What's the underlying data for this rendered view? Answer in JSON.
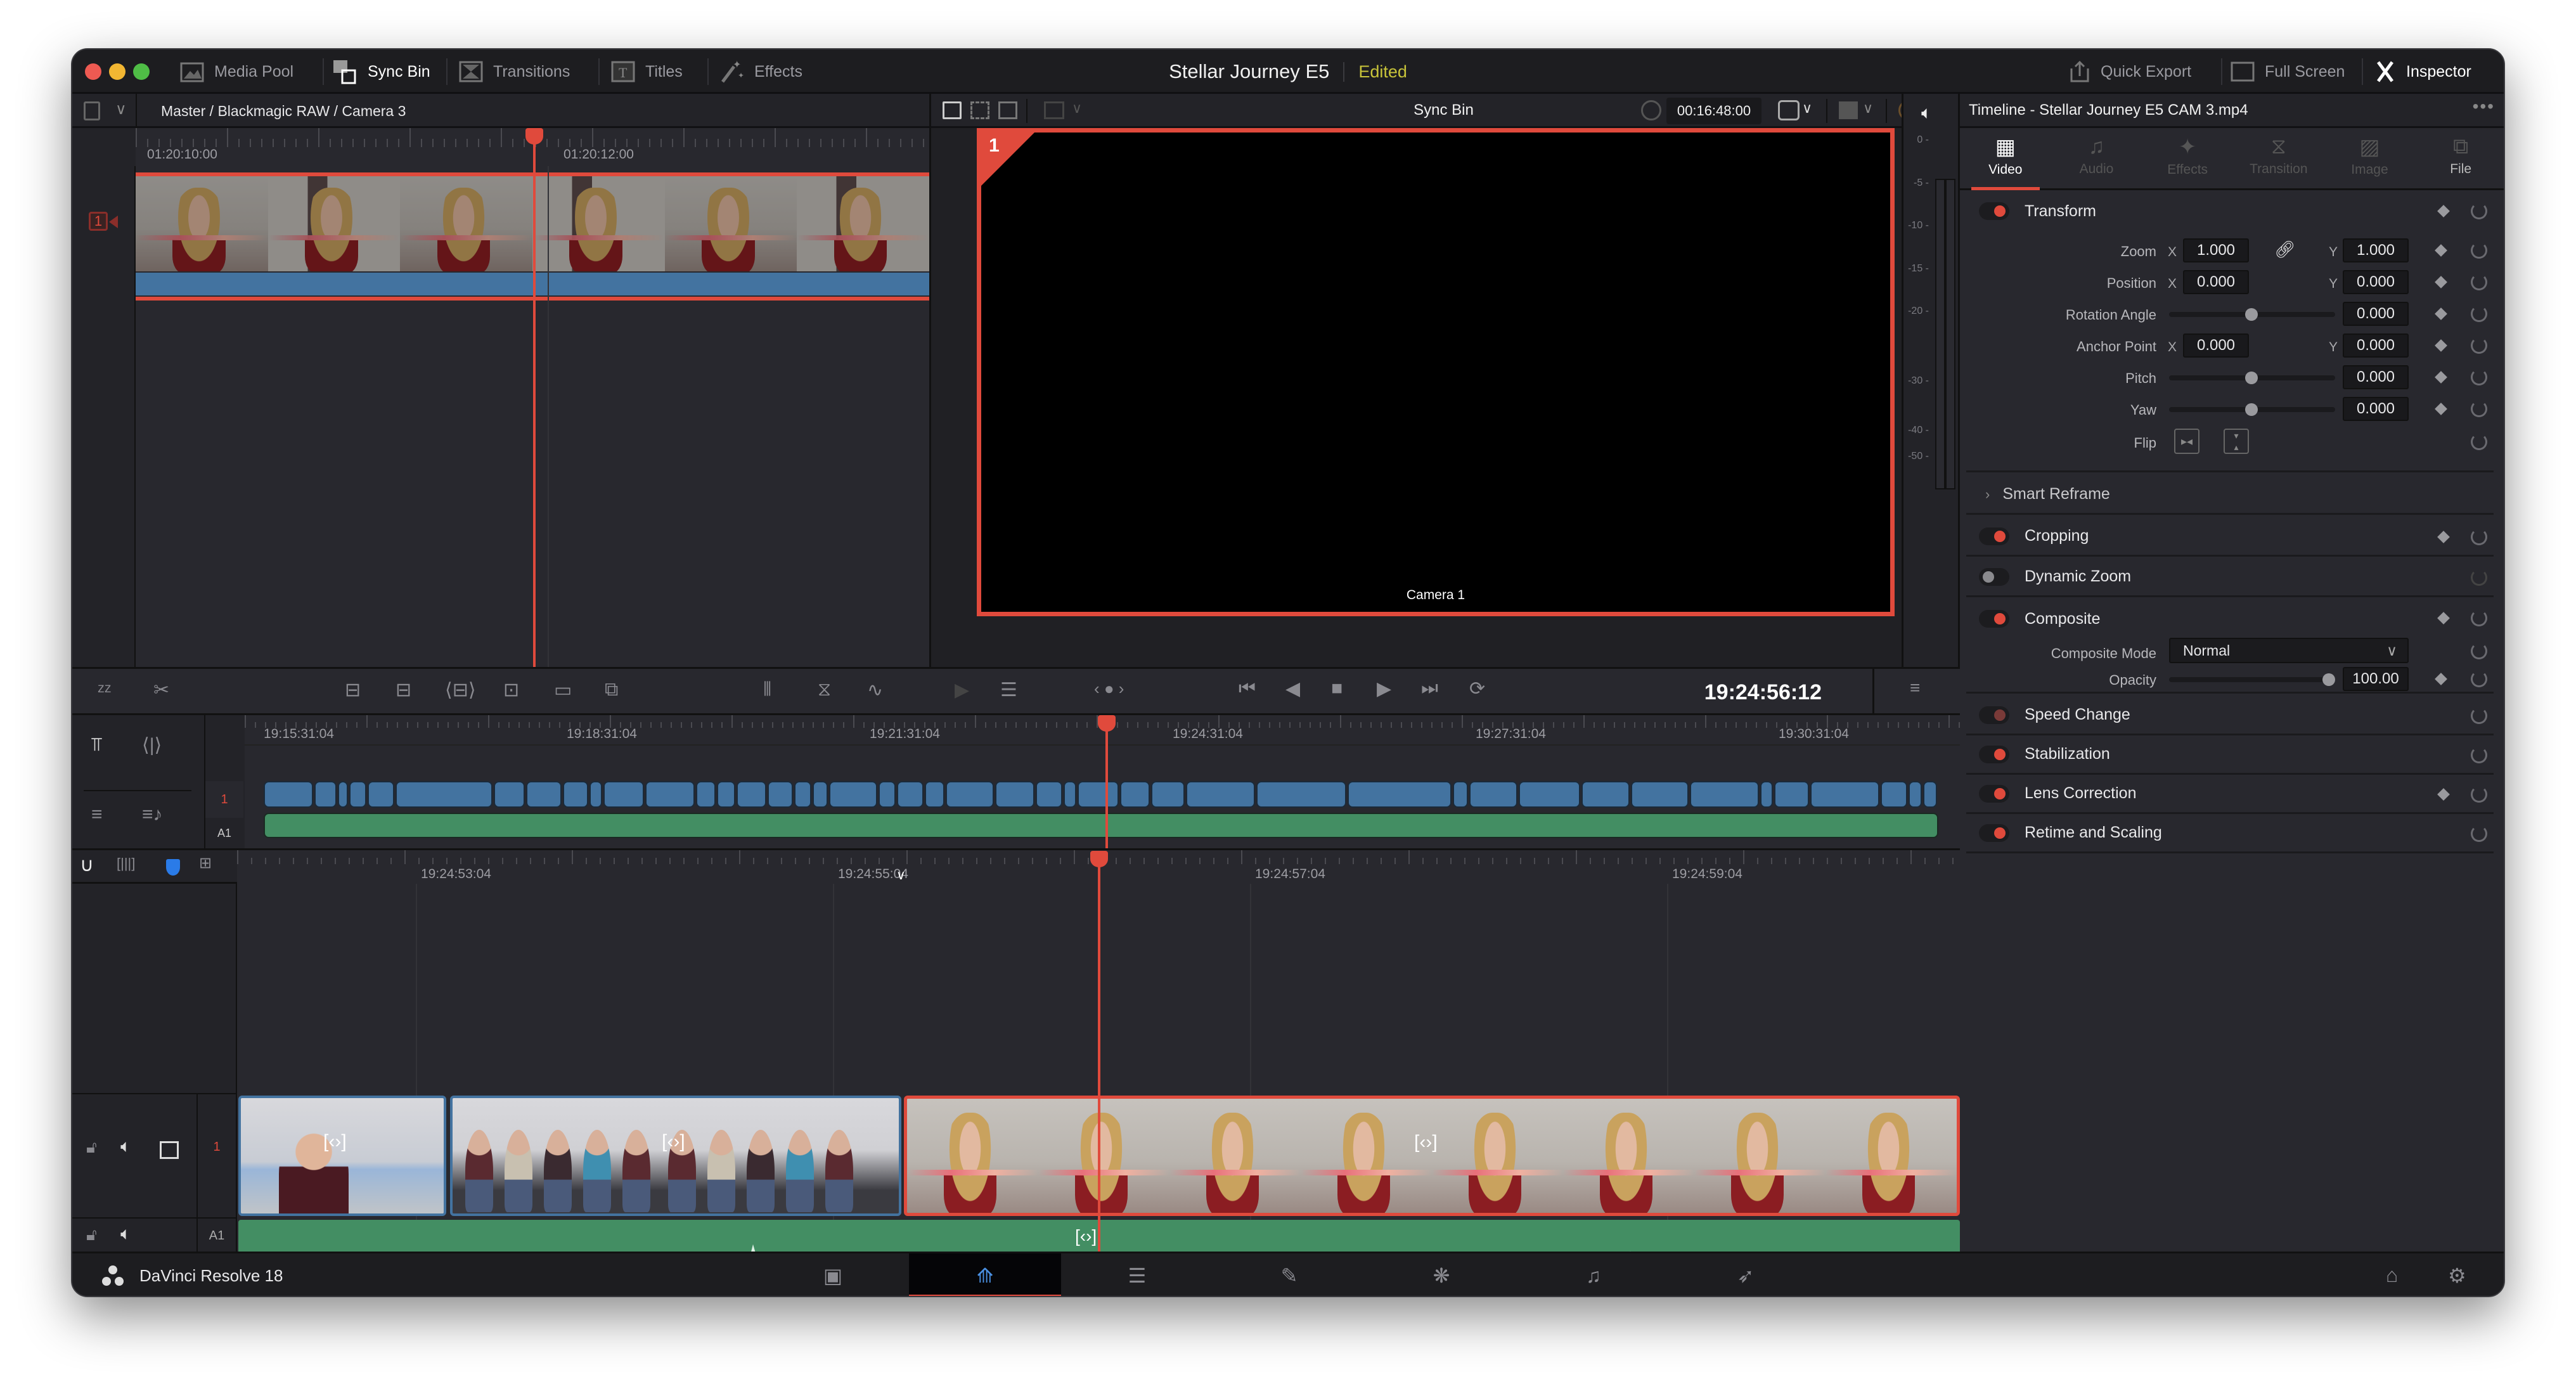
{
  "window": {
    "title": "Stellar Journey E5",
    "status": "Edited",
    "accent_color": "#e04a3c",
    "edited_color": "#c8c43a"
  },
  "topbar": {
    "left_items": [
      {
        "label": "Media Pool",
        "icon": "media-pool-icon",
        "active": false
      },
      {
        "label": "Sync Bin",
        "icon": "sync-bin-icon",
        "active": true
      },
      {
        "label": "Transitions",
        "icon": "transitions-icon",
        "active": false
      },
      {
        "label": "Titles",
        "icon": "titles-icon",
        "active": false
      },
      {
        "label": "Effects",
        "icon": "effects-icon",
        "active": false
      }
    ],
    "right_items": [
      {
        "label": "Quick Export",
        "icon": "export-icon"
      },
      {
        "label": "Full Screen",
        "icon": "fullscreen-icon"
      },
      {
        "label": "Inspector",
        "icon": "inspector-icon"
      }
    ]
  },
  "source": {
    "breadcrumb": "Master / Blackmagic RAW / Camera 3",
    "ruler_labels": [
      "01:20:10:00",
      "01:20:12:00"
    ],
    "camera_badge": "1"
  },
  "viewer": {
    "title": "Sync Bin",
    "timecode": "00:16:48:00",
    "angle_number": "1",
    "angle_label": "Camera 1",
    "playback_timecode": "19:24:56:12"
  },
  "audio_meter": {
    "scale": [
      "0",
      "-5",
      "-10",
      "-15",
      "-20",
      "-30",
      "-40",
      "-50"
    ]
  },
  "inspector": {
    "header": "Timeline - Stellar Journey E5 CAM 3.mp4",
    "tabs": [
      {
        "label": "Video",
        "active": true
      },
      {
        "label": "Audio",
        "active": false
      },
      {
        "label": "Effects",
        "active": false
      },
      {
        "label": "Transition",
        "active": false
      },
      {
        "label": "Image",
        "active": false
      },
      {
        "label": "File",
        "active": false
      }
    ],
    "transform": {
      "title": "Transform",
      "zoom_label": "Zoom",
      "zoom_x": "1.000",
      "zoom_y": "1.000",
      "position_label": "Position",
      "position_x": "0.000",
      "position_y": "0.000",
      "rotation_label": "Rotation Angle",
      "rotation": "0.000",
      "anchor_label": "Anchor Point",
      "anchor_x": "0.000",
      "anchor_y": "0.000",
      "pitch_label": "Pitch",
      "pitch": "0.000",
      "yaw_label": "Yaw",
      "yaw": "0.000",
      "flip_label": "Flip",
      "x_label": "X",
      "y_label": "Y"
    },
    "smart_reframe": "Smart Reframe",
    "cropping": "Cropping",
    "dynamic_zoom": "Dynamic Zoom",
    "composite": {
      "title": "Composite",
      "mode_label": "Composite Mode",
      "mode_value": "Normal",
      "opacity_label": "Opacity",
      "opacity_value": "100.00"
    },
    "speed_change": "Speed Change",
    "stabilization": "Stabilization",
    "lens_correction": "Lens Correction",
    "retime_scaling": "Retime and Scaling"
  },
  "upper_timeline": {
    "labels": [
      "19:15:31:04",
      "19:18:31:04",
      "19:21:31:04",
      "19:24:31:04",
      "19:27:31:04",
      "19:30:31:04"
    ],
    "track_video": "1",
    "track_audio": "A1"
  },
  "lower_timeline": {
    "labels": [
      "19:24:53:04",
      "19:24:55:04",
      "19:24:57:04",
      "19:24:59:04"
    ],
    "track_video": "1",
    "track_audio": "A1"
  },
  "bottombar": {
    "app_name": "DaVinci Resolve 18",
    "pages": [
      "media",
      "cut",
      "edit",
      "fusion",
      "color",
      "fairlight",
      "deliver"
    ],
    "active_page": "cut"
  }
}
